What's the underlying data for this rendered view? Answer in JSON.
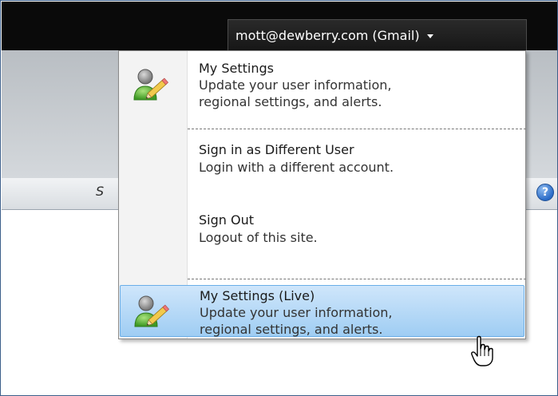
{
  "header": {
    "account_label": "mott@dewberry.com (Gmail)",
    "partial_nav_text": "S"
  },
  "menu": {
    "items": [
      {
        "title": "My Settings",
        "desc_line1": "Update your user information,",
        "desc_line2": "regional settings, and alerts.",
        "icon": "user-edit-icon"
      },
      {
        "title": "Sign in as Different User",
        "desc_line1": "Login with a different account."
      },
      {
        "title": "Sign Out",
        "desc_line1": "Logout of this site."
      },
      {
        "title": "My Settings (Live)",
        "desc_line1": "Update your user information,",
        "desc_line2": "regional settings, and alerts.",
        "icon": "user-edit-icon",
        "state": "hovered"
      }
    ]
  },
  "icons": {
    "help": "?"
  },
  "colors": {
    "top_bar": "#0a0a0a",
    "hover_highlight": "#9fcdf3",
    "help_icon": "#2a6bc7"
  }
}
